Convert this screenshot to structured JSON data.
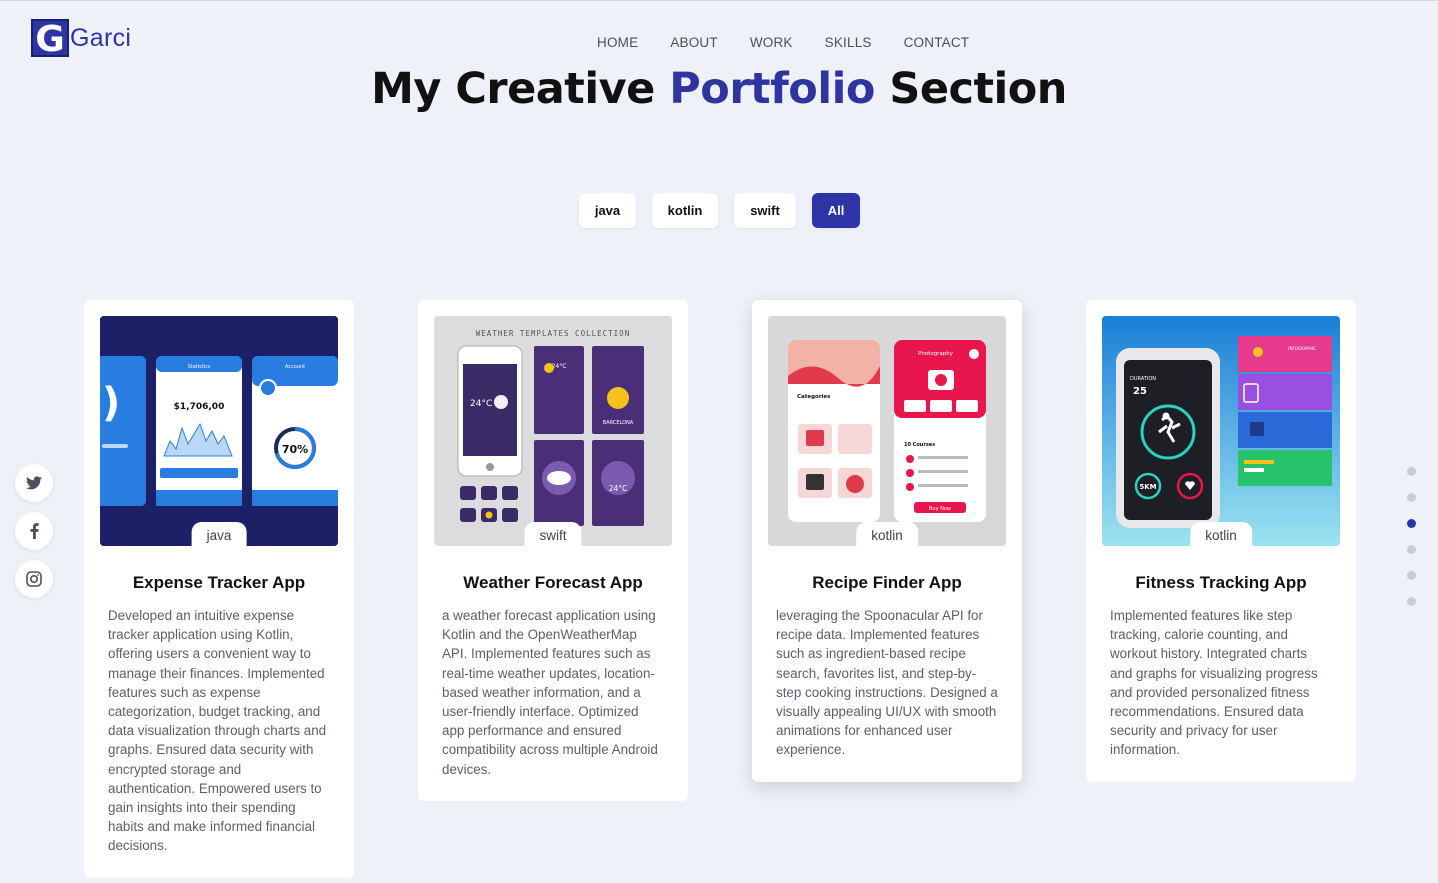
{
  "brand": {
    "logo_letter": "G",
    "logo_text": "Garci",
    "accent_color": "#2d35a6"
  },
  "nav": {
    "items": [
      {
        "label": "HOME"
      },
      {
        "label": "ABOUT"
      },
      {
        "label": "WORK"
      },
      {
        "label": "SKILLS"
      },
      {
        "label": "CONTACT"
      }
    ]
  },
  "page": {
    "title_prefix": "My Creative ",
    "title_accent": "Portfolio",
    "title_suffix": " Section"
  },
  "filters": {
    "items": [
      {
        "label": "java"
      },
      {
        "label": "kotlin"
      },
      {
        "label": "swift"
      },
      {
        "label": "All"
      }
    ],
    "active": "All"
  },
  "social": {
    "items": [
      "twitter-icon",
      "facebook-icon",
      "instagram-icon"
    ]
  },
  "pager": {
    "dot_count": 6,
    "active_index": 2
  },
  "projects": [
    {
      "tag": "java",
      "title": "Expense Tracker App",
      "description": "Developed an intuitive expense tracker application using Kotlin, offering users a convenient way to manage their finances. Implemented features such as expense categorization, budget tracking, and data visualization through charts and graphs. Ensured data security with encrypted storage and authentication. Empowered users to gain insights into their spending habits and make informed financial decisions.",
      "image_text": {
        "statistics": "Statistics",
        "balance": "$1,706,00",
        "account": "Account",
        "percent": "70%"
      }
    },
    {
      "tag": "swift",
      "title": "Weather Forecast App",
      "description": "a weather forecast application using Kotlin and the OpenWeatherMap API. Implemented features such as real-time weather updates, location-based weather information, and a user-friendly interface. Optimized app performance and ensured compatibility across multiple Android devices.",
      "image_text": {
        "header": "WEATHER TEMPLATES COLLECTION",
        "temp1": "24°C",
        "temp2": "24°C",
        "city": "BARCELONA",
        "temp3": "24°C"
      }
    },
    {
      "tag": "kotlin",
      "title": "Recipe Finder App",
      "description": "leveraging the Spoonacular API for recipe data. Implemented features such as ingredient-based recipe search, favorites list, and step-by-step cooking instructions. Designed a visually appealing UI/UX with smooth animations for enhanced user experience.",
      "image_text": {
        "categories": "Categories",
        "photography": "Photography",
        "courses": "10 Courses",
        "buy": "Buy Now"
      }
    },
    {
      "tag": "kotlin",
      "title": "Fitness Tracking App",
      "description": "Implemented features like step tracking, calorie counting, and workout history. Integrated charts and graphs for visualizing progress and provided personalized fitness recommendations. Ensured data security and privacy for user information.",
      "image_text": {
        "duration": "DURATION",
        "minutes": "25",
        "distance": "5KM",
        "infographic": "INFOGRAPHIC"
      }
    }
  ]
}
